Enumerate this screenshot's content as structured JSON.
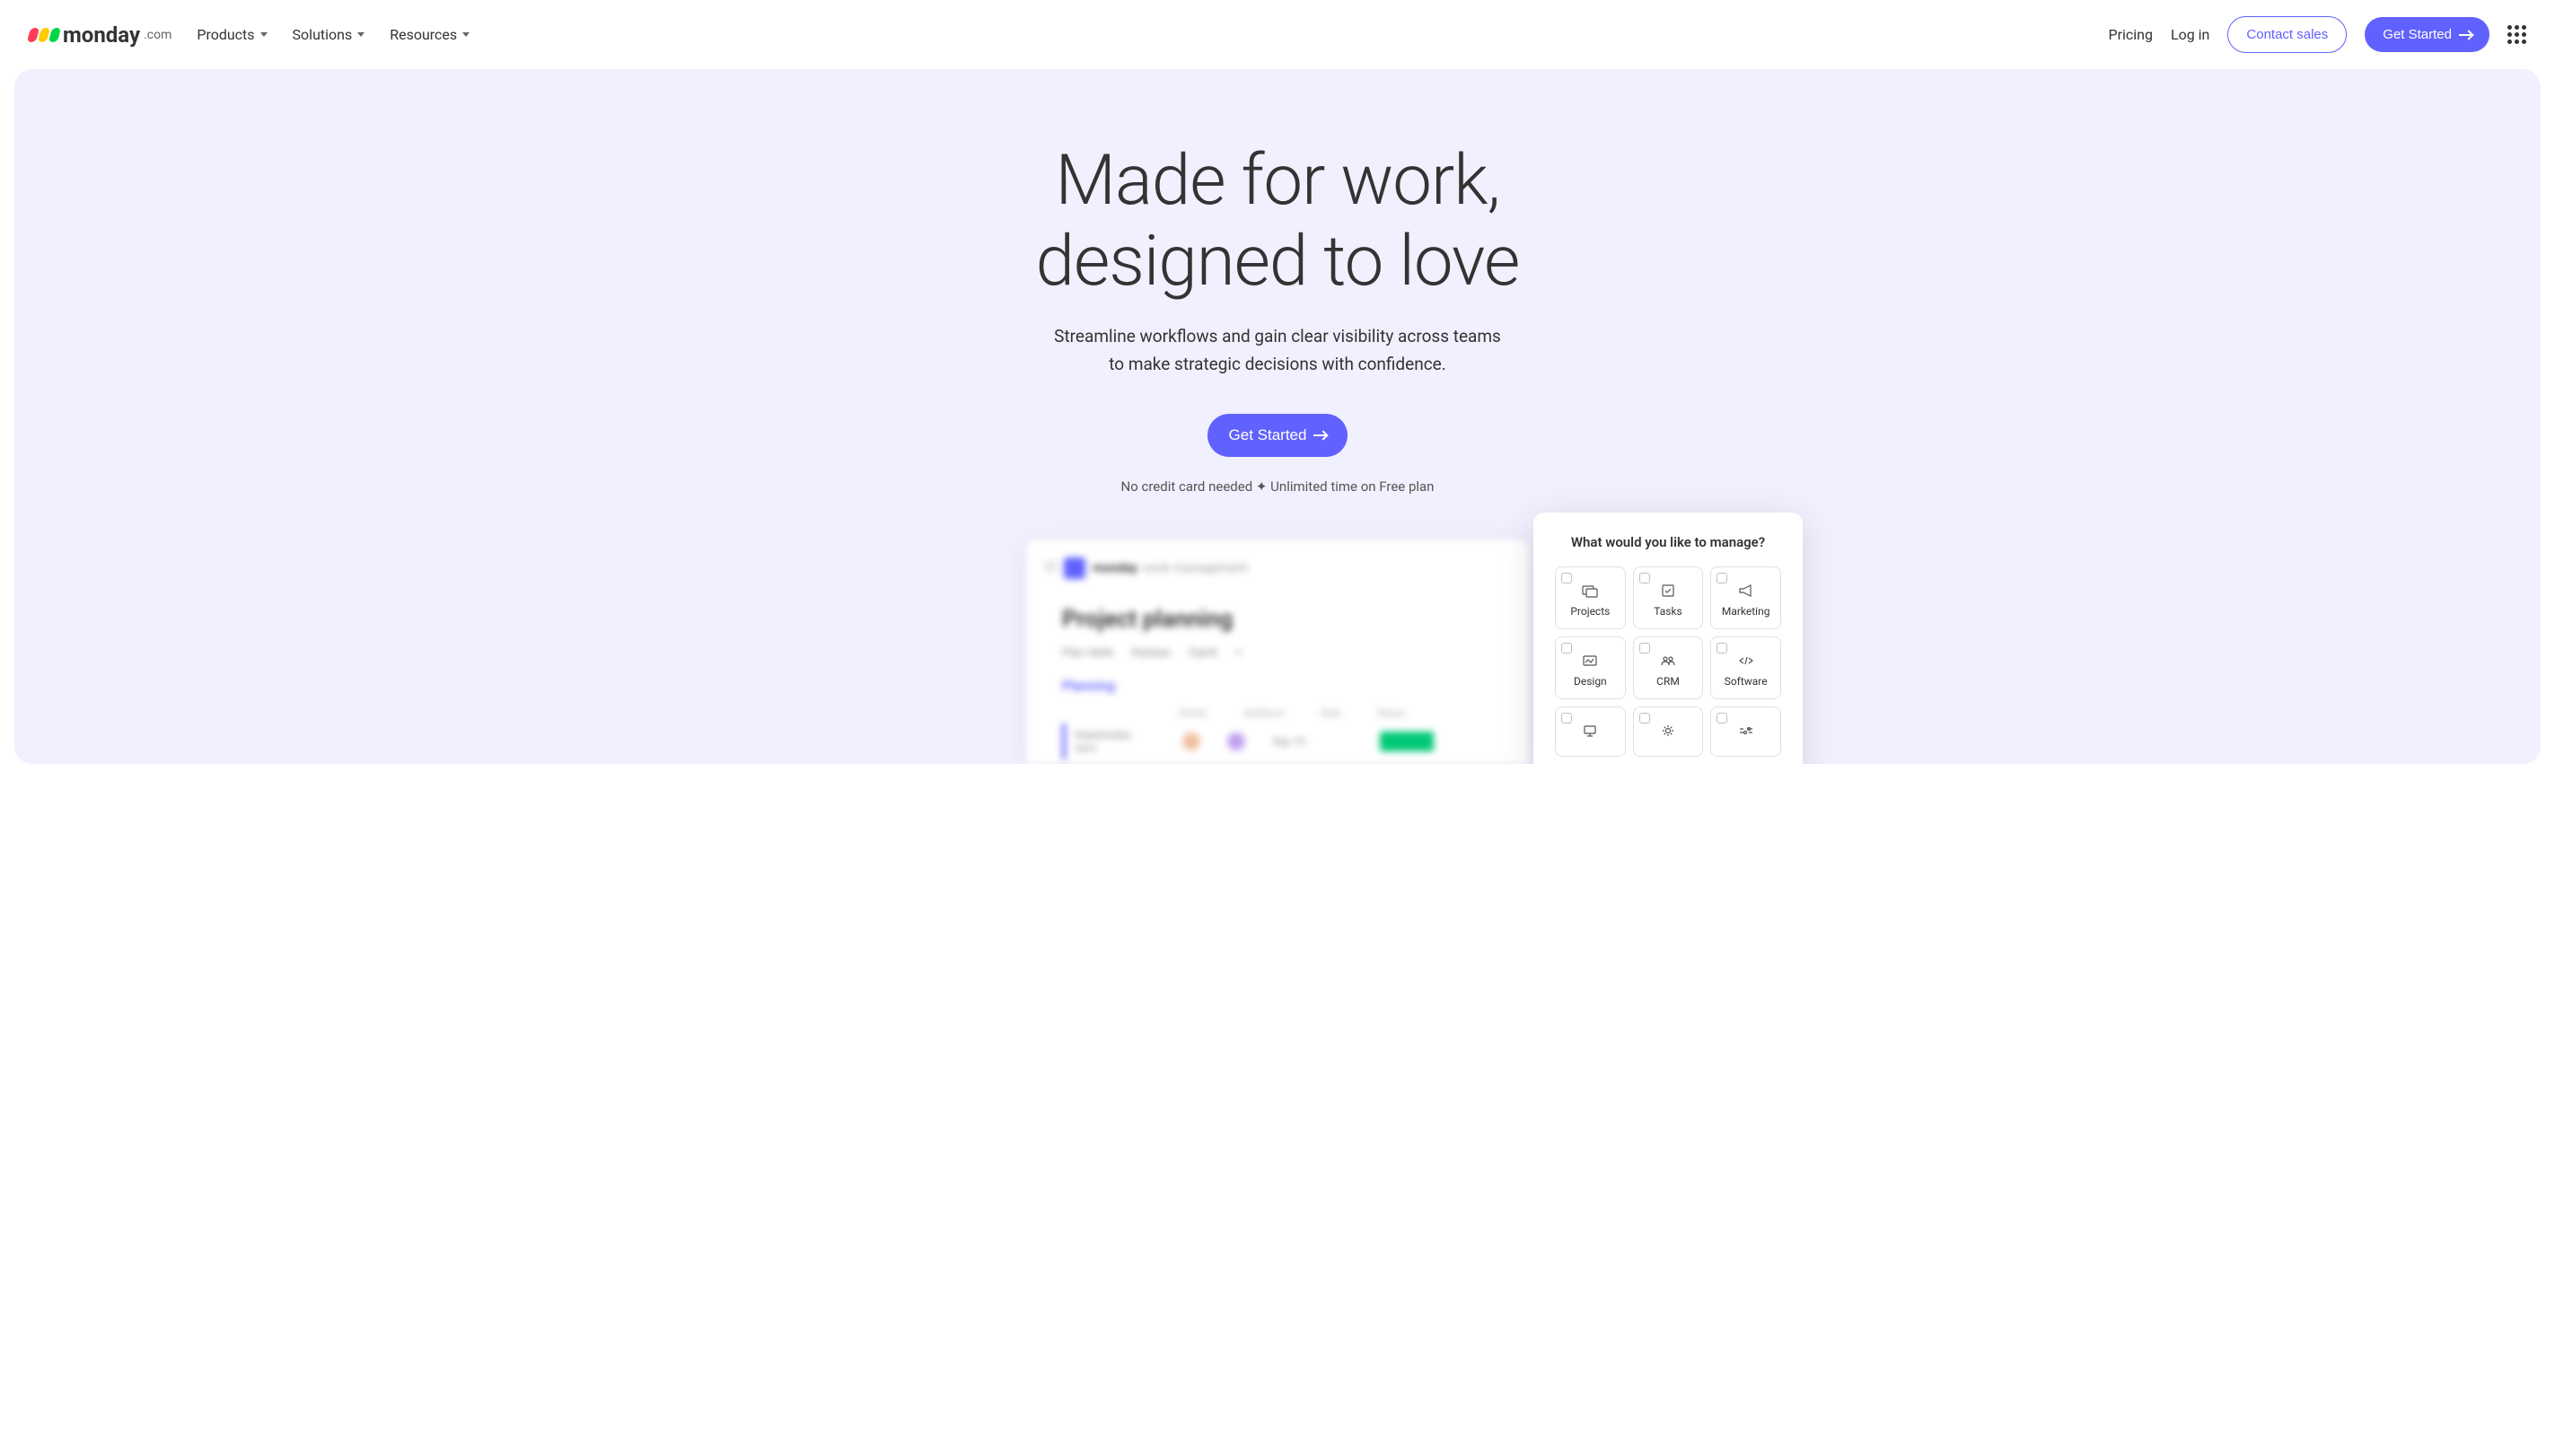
{
  "header": {
    "logo": {
      "name": "monday",
      "suffix": ".com"
    },
    "nav": [
      {
        "label": "Products"
      },
      {
        "label": "Solutions"
      },
      {
        "label": "Resources"
      }
    ],
    "links": {
      "pricing": "Pricing",
      "login": "Log in"
    },
    "contact_sales": "Contact sales",
    "get_started": "Get Started"
  },
  "hero": {
    "title_line1": "Made for work,",
    "title_line2": "designed to love",
    "subtitle_line1": "Streamline workflows and gain clear visibility across teams",
    "subtitle_line2": "to make strategic decisions with confidence.",
    "cta": "Get Started",
    "note": "No credit card needed   ✦   Unlimited time on Free plan"
  },
  "preview": {
    "brand": "monday",
    "product": "work management",
    "board_title": "Project planning",
    "tabs": [
      "Plan table",
      "Kanban",
      "Gantt"
    ],
    "group": "Planning",
    "columns": [
      "Owner",
      "Additions",
      "Date",
      "Status"
    ],
    "row_task": "Stakeholder sync",
    "row_date": "Sep 10",
    "row_status": "Done"
  },
  "survey": {
    "title": "What would you like to manage?",
    "options": [
      {
        "label": "Projects",
        "icon": "projects-icon"
      },
      {
        "label": "Tasks",
        "icon": "tasks-icon"
      },
      {
        "label": "Marketing",
        "icon": "marketing-icon"
      },
      {
        "label": "Design",
        "icon": "design-icon"
      },
      {
        "label": "CRM",
        "icon": "crm-icon"
      },
      {
        "label": "Software",
        "icon": "software-icon"
      },
      {
        "label": "",
        "icon": "it-icon"
      },
      {
        "label": "",
        "icon": "ops-icon"
      },
      {
        "label": "",
        "icon": "product-icon"
      }
    ]
  }
}
